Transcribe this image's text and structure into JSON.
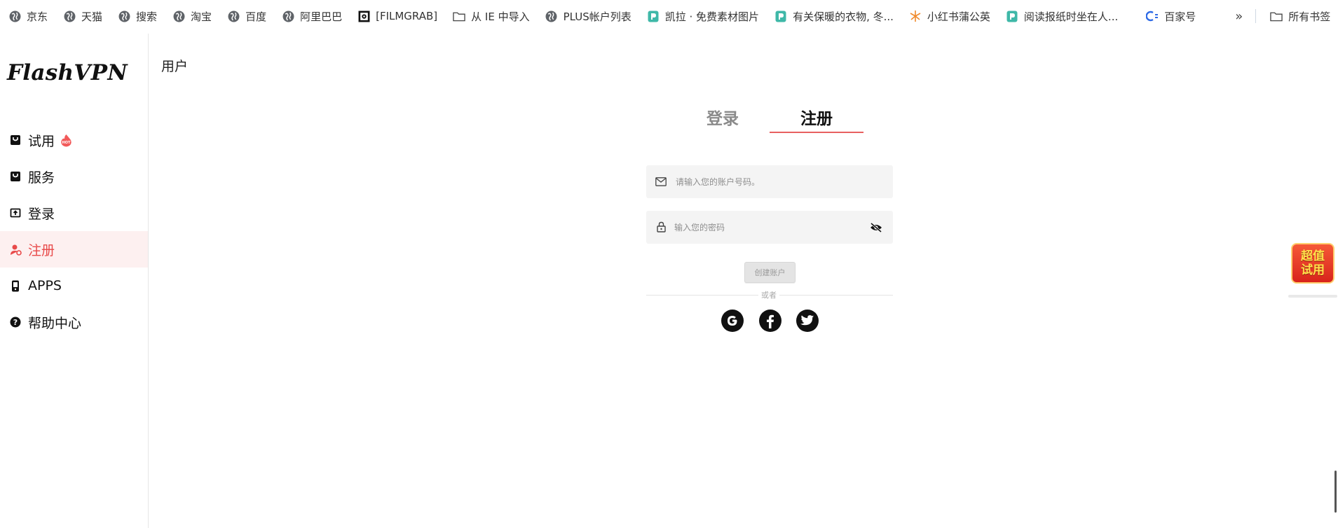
{
  "bookmarks": {
    "items": [
      {
        "label": "京东",
        "icon": "globe-icon"
      },
      {
        "label": "天猫",
        "icon": "globe-icon"
      },
      {
        "label": "搜索",
        "icon": "globe-icon"
      },
      {
        "label": "淘宝",
        "icon": "globe-icon"
      },
      {
        "label": "百度",
        "icon": "globe-icon"
      },
      {
        "label": "阿里巴巴",
        "icon": "globe-icon"
      },
      {
        "label": "[FILMGRAB]",
        "icon": "filmgrab-icon"
      },
      {
        "label": "从 IE 中导入",
        "icon": "folder-icon"
      },
      {
        "label": "PLUS帐户列表",
        "icon": "globe-icon"
      },
      {
        "label": "凯拉 · 免费素材图片",
        "icon": "doc-icon"
      },
      {
        "label": "有关保暖的衣物, 冬...",
        "icon": "doc-icon"
      },
      {
        "label": "小红书蒲公英",
        "icon": "dandelion-icon"
      },
      {
        "label": "阅读报纸时坐在人...",
        "icon": "doc-icon"
      },
      {
        "label": "百家号",
        "icon": "baijiahao-icon"
      }
    ],
    "more": "»",
    "all_bookmarks": "所有书签"
  },
  "sidebar": {
    "logo": "FlashVPN",
    "items": [
      {
        "label": "试用",
        "icon": "bag-icon",
        "badge": "HOT"
      },
      {
        "label": "服务",
        "icon": "bag-icon"
      },
      {
        "label": "登录",
        "icon": "login-icon"
      },
      {
        "label": "注册",
        "icon": "user-add-icon",
        "active": true
      },
      {
        "label": "APPS",
        "icon": "phone-icon"
      },
      {
        "label": "帮助中心",
        "icon": "help-icon"
      }
    ]
  },
  "main": {
    "title": "用户",
    "tabs": {
      "login": "登录",
      "register": "注册"
    },
    "account_placeholder": "请输入您的账户号码。",
    "password_placeholder": "输入您的密码",
    "create_button": "创建账户",
    "or_text": "或者"
  },
  "promo": {
    "line1": "超值",
    "line2": "试用"
  },
  "colors": {
    "accent": "#e84a4a",
    "active_bg": "#fdf0f0",
    "field_bg": "#f4f4f4"
  }
}
